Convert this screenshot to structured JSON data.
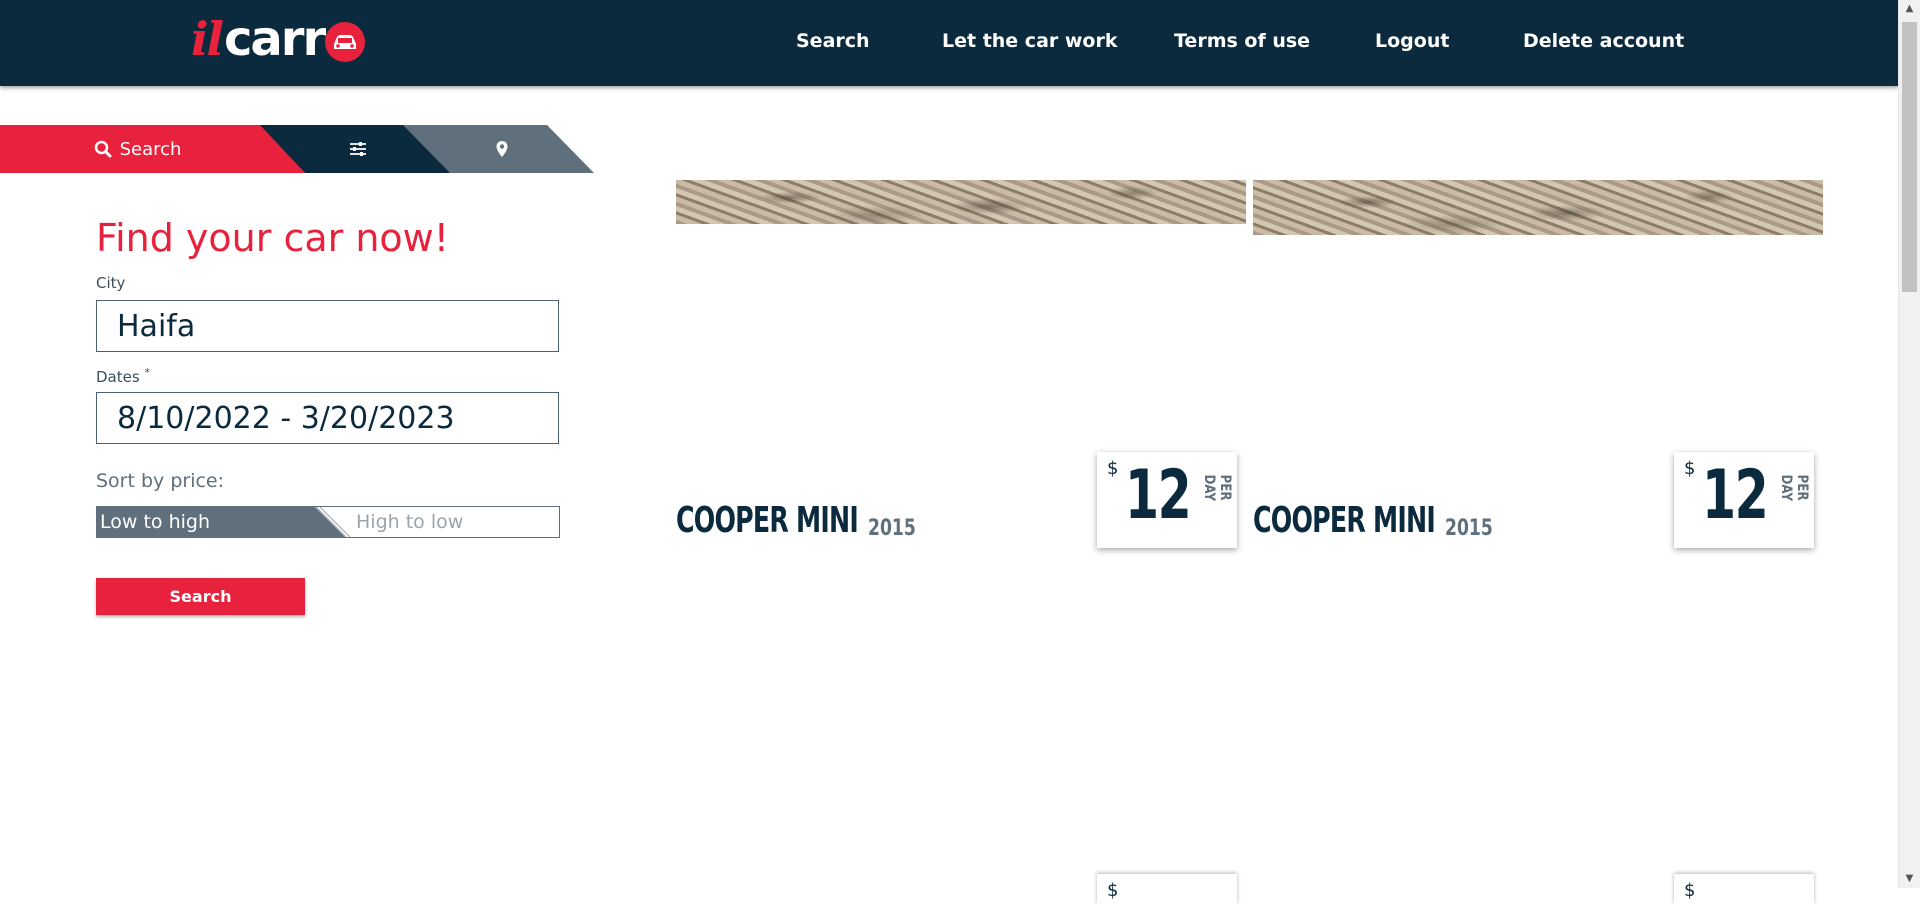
{
  "header": {
    "logo": {
      "prefix": "il",
      "main": "carr"
    },
    "nav": [
      {
        "label": "Search"
      },
      {
        "label": "Let the car work"
      },
      {
        "label": "Terms of use"
      },
      {
        "label": "Logout"
      },
      {
        "label": "Delete account"
      }
    ]
  },
  "tabs": {
    "search_label": "Search",
    "filter_icon": "sliders-icon",
    "location_icon": "map-marker-icon"
  },
  "form": {
    "title": "Find your car now!",
    "city_label": "City",
    "city_value": "Haifa",
    "dates_label": "Dates",
    "dates_required_mark": "*",
    "dates_value": "8/10/2022 - 3/20/2023",
    "sort_label": "Sort by price:",
    "sort_low": "Low to high",
    "sort_high": "High to low",
    "search_button": "Search"
  },
  "cars": [
    {
      "name": "COOPER MINI",
      "year": "2015",
      "currency": "$",
      "price": "12",
      "unit": "PER DAY"
    },
    {
      "name": "COOPER MINI",
      "year": "2015",
      "currency": "$",
      "price": "12",
      "unit": "PER DAY"
    }
  ],
  "next_row": {
    "currency": "$"
  },
  "colors": {
    "navy": "#0b2a3d",
    "red": "#e8213d",
    "slate": "#5f6f7c"
  }
}
